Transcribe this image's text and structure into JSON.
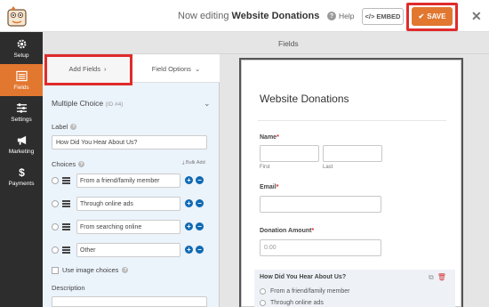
{
  "header": {
    "title_prefix": "Now editing",
    "title_form": "Website Donations",
    "help_label": "Help",
    "embed_label": "EMBED",
    "save_label": "SAVE"
  },
  "rail": {
    "items": [
      {
        "label": "Setup",
        "icon": "gear-icon"
      },
      {
        "label": "Fields",
        "icon": "fields-icon"
      },
      {
        "label": "Settings",
        "icon": "sliders-icon"
      },
      {
        "label": "Marketing",
        "icon": "megaphone-icon"
      },
      {
        "label": "Payments",
        "icon": "dollar-icon"
      }
    ],
    "active": "Fields"
  },
  "subheader": {
    "title": "Fields"
  },
  "panel": {
    "tabs": {
      "add_fields": "Add Fields",
      "field_options": "Field Options"
    },
    "field_type": "Multiple Choice",
    "field_id": "(ID #4)",
    "label_caption": "Label",
    "label_value": "How Did You Hear About Us?",
    "choices_caption": "Choices",
    "bulk_add": "Bulk Add",
    "choices": [
      "From a friend/family member",
      "Through online ads",
      "From searching online",
      "Other"
    ],
    "image_choices": "Use image choices",
    "description_caption": "Description"
  },
  "form": {
    "title": "Website Donations",
    "name_label": "Name",
    "first_label": "First",
    "last_label": "Last",
    "email_label": "Email",
    "donation_label": "Donation Amount",
    "donation_placeholder": "0.00",
    "question_title": "How Did You Hear About Us?",
    "question_options": [
      "From a friend/family member",
      "Through online ads"
    ]
  },
  "colors": {
    "accent": "#e27730",
    "highlight": "#e02b2b",
    "rail_bg": "#2d2d2d",
    "button_blue": "#0e69b3"
  }
}
